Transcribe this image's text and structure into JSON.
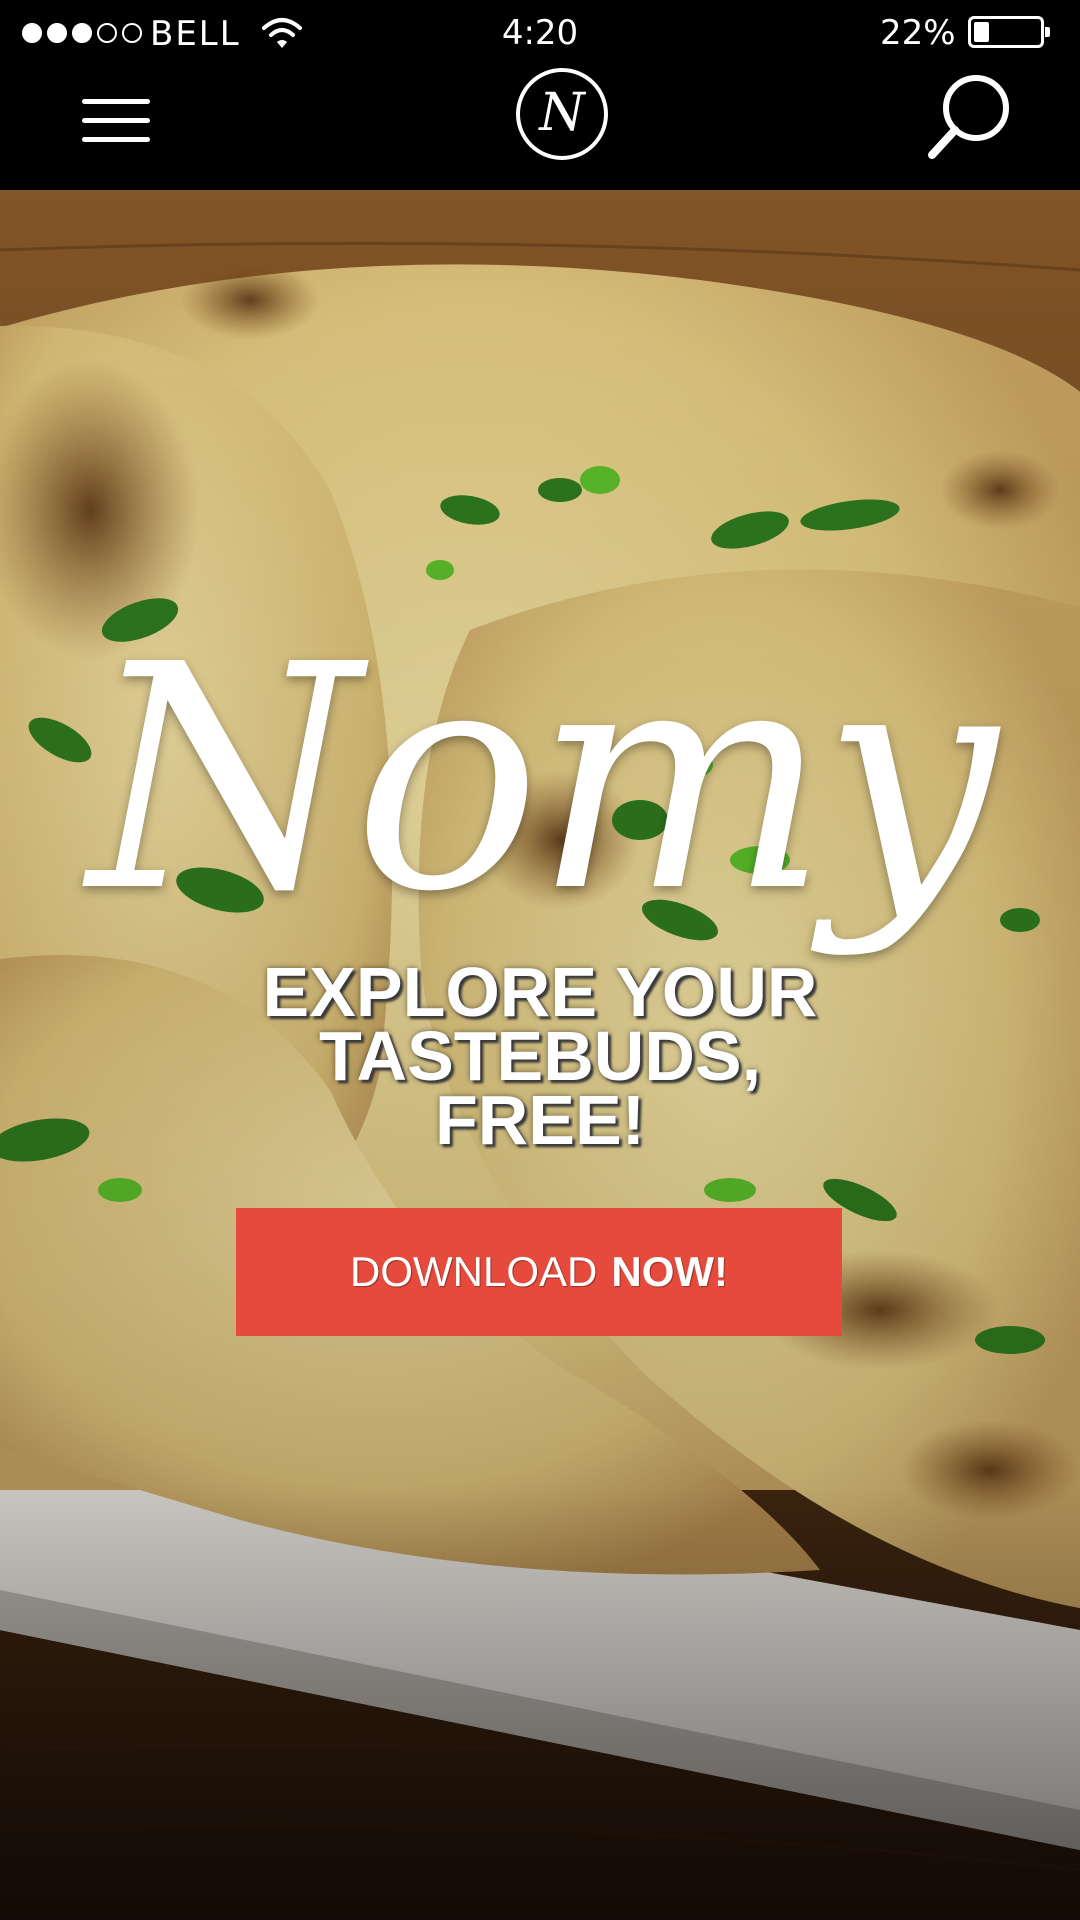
{
  "status_bar": {
    "carrier": "BELL",
    "time": "4:20",
    "battery_percent_label": "22%",
    "battery_level": 0.22,
    "signal_bars_filled": 3,
    "signal_bars_total": 5
  },
  "nav": {
    "logo_letter": "N",
    "icons": [
      "hamburger-menu-icon",
      "logo-badge",
      "search-icon"
    ]
  },
  "hero": {
    "brand_name": "Nomy",
    "tagline_lines": [
      "EXPLORE YOUR",
      "TASTEBUDS,",
      "FREE!"
    ],
    "cta_primary": "DOWNLOAD",
    "cta_emphasis": "NOW!",
    "cta_color": "#e64a3c"
  }
}
